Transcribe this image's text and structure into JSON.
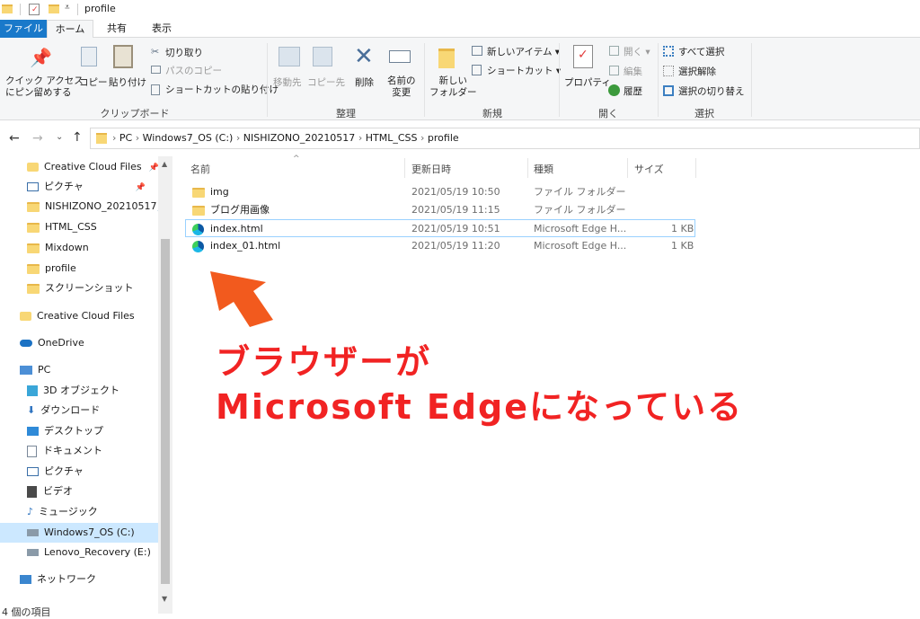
{
  "window": {
    "title": "profile"
  },
  "ribbon_tabs": {
    "file": "ファイル",
    "home": "ホーム",
    "share": "共有",
    "view": "表示"
  },
  "ribbon": {
    "clipboard": {
      "pin": "クイック アクセス",
      "pin2": "にピン留めする",
      "copy": "コピー",
      "paste": "貼り付け",
      "cut": "切り取り",
      "copy_path": "パスのコピー",
      "paste_shortcut": "ショートカットの貼り付け",
      "label": "クリップボード"
    },
    "organize": {
      "move_to": "移動先",
      "copy_to": "コピー先",
      "delete": "削除",
      "rename1": "名前の",
      "rename2": "変更",
      "label": "整理"
    },
    "new": {
      "new_folder1": "新しい",
      "new_folder2": "フォルダー",
      "new_item": "新しいアイテム ▾",
      "easy_access": "ショートカット ▾",
      "label": "新規"
    },
    "open": {
      "properties": "プロパティ",
      "open": "開く ▾",
      "edit": "編集",
      "history": "履歴",
      "label": "開く"
    },
    "select": {
      "select_all": "すべて選択",
      "select_none": "選択解除",
      "invert": "選択の切り替え",
      "label": "選択"
    }
  },
  "address": {
    "crumbs": [
      "PC",
      "Windows7_OS (C:)",
      "NISHIZONO_20210517",
      "HTML_CSS",
      "profile"
    ]
  },
  "nav": {
    "items": [
      "Creative Cloud Files",
      "ピクチャ",
      "NISHIZONO_20210517",
      "HTML_CSS",
      "Mixdown",
      "profile",
      "スクリーンショット",
      "Creative Cloud Files",
      "OneDrive",
      "PC",
      "3D オブジェクト",
      "ダウンロード",
      "デスクトップ",
      "ドキュメント",
      "ピクチャ",
      "ビデオ",
      "ミュージック",
      "Windows7_OS (C:)",
      "Lenovo_Recovery (E:)",
      "ネットワーク"
    ]
  },
  "list": {
    "headers": {
      "name": "名前",
      "date": "更新日時",
      "type": "種類",
      "size": "サイズ"
    },
    "rows": [
      {
        "name": "img",
        "date": "2021/05/19 10:50",
        "type": "ファイル フォルダー",
        "size": "",
        "icon": "folder-icon"
      },
      {
        "name": "ブログ用画像",
        "date": "2021/05/19 11:15",
        "type": "ファイル フォルダー",
        "size": "",
        "icon": "folder-icon"
      },
      {
        "name": "index.html",
        "date": "2021/05/19 10:51",
        "type": "Microsoft Edge H...",
        "size": "1 KB",
        "icon": "edge-icon"
      },
      {
        "name": "index_01.html",
        "date": "2021/05/19 11:20",
        "type": "Microsoft Edge H...",
        "size": "1 KB",
        "icon": "edge-icon"
      }
    ]
  },
  "status": {
    "count": "4 個の項目"
  },
  "annotation": {
    "line1": "ブラウザーが",
    "line2": "Microsoft Edgeになっている"
  },
  "colors": {
    "accent": "#1979ca",
    "annotation_red": "#f12323",
    "arrow": "#f25a1e"
  }
}
